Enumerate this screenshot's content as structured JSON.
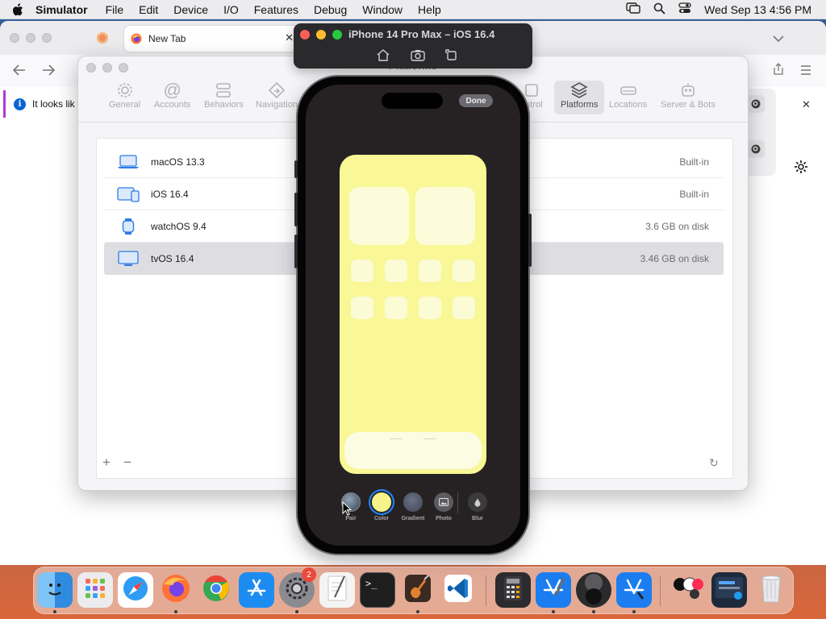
{
  "menubar": {
    "app_name": "Simulator",
    "items": [
      "File",
      "Edit",
      "Device",
      "I/O",
      "Features",
      "Debug",
      "Window",
      "Help"
    ],
    "clock": "Wed Sep 13  4:56 PM"
  },
  "browser": {
    "tab_title": "New Tab",
    "notification_text": "It looks lik"
  },
  "settings": {
    "window_title": "Platforms",
    "toolbar": [
      {
        "label": "General",
        "icon": "gear-icon"
      },
      {
        "label": "Accounts",
        "icon": "at-icon"
      },
      {
        "label": "Behaviors",
        "icon": "behaviors-icon"
      },
      {
        "label": "Navigation",
        "icon": "navigation-icon"
      },
      {
        "label": "ontrol",
        "icon": "source-control-icon"
      },
      {
        "label": "Platforms",
        "icon": "layers-icon",
        "active": true
      },
      {
        "label": "Locations",
        "icon": "drive-icon"
      },
      {
        "label": "Server & Bots",
        "icon": "robot-icon"
      }
    ],
    "platforms": [
      {
        "name": "macOS 13.3",
        "size": "Built-in",
        "icon": "laptop-icon"
      },
      {
        "name": "iOS 16.4",
        "size": "Built-in",
        "icon": "devices-icon"
      },
      {
        "name": "watchOS 9.4",
        "size": "3.6 GB on disk",
        "icon": "watch-icon"
      },
      {
        "name": "tvOS 16.4",
        "size": "3.46 GB on disk",
        "icon": "tv-icon",
        "selected": true
      }
    ],
    "add_label": "+",
    "remove_label": "−",
    "refresh_glyph": "↻"
  },
  "simulator": {
    "title": "iPhone 14 Pro Max – iOS 16.4",
    "done_label": "Done",
    "picker": [
      {
        "label": "Pair",
        "color": "#4c5d6e"
      },
      {
        "label": "Color",
        "color": "#f6f38a"
      },
      {
        "label": "Gradient",
        "color": "#4f5666"
      },
      {
        "label": "Photo",
        "color": "#5b5b60"
      },
      {
        "label": "Blur",
        "color": "#3b3b3e"
      }
    ]
  },
  "dock": {
    "items": [
      "Finder",
      "Launchpad",
      "Safari",
      "Firefox",
      "Chrome",
      "App Store",
      "System Settings",
      "TextEdit",
      "Terminal",
      "Instruments",
      "Visual Studio Code",
      "Calculator",
      "Xcode",
      "Simulator",
      "Xcode Beta",
      "Preview",
      "Screen Sharing",
      "Trash"
    ],
    "settings_badge": "2"
  },
  "colors": {
    "accent": "#0a64d6",
    "wallpaper_preview": "#f9f796",
    "notification_border": "#b03bd8"
  }
}
